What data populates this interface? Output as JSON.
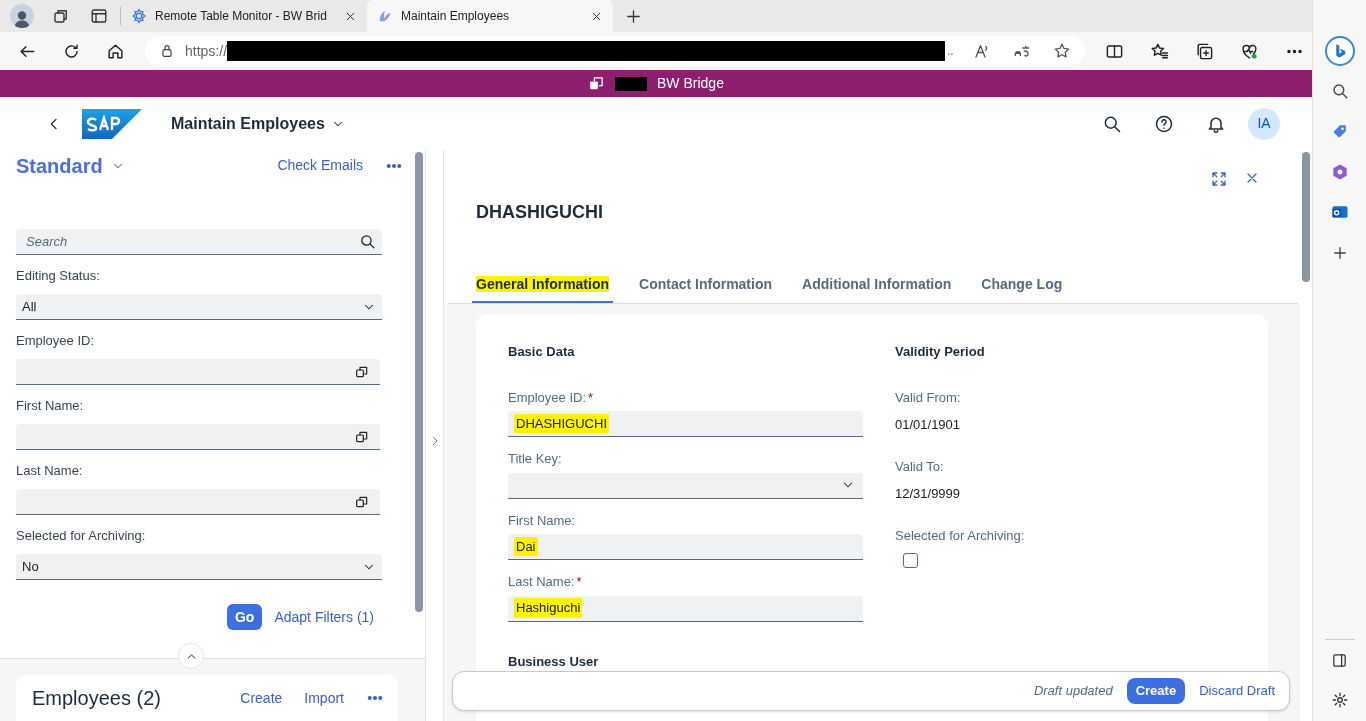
{
  "browser": {
    "tabs": [
      {
        "title": "Remote Table Monitor - BW Brid",
        "selected": false
      },
      {
        "title": "Maintain Employees",
        "selected": true
      }
    ],
    "url": "https://",
    "url_end": ".."
  },
  "banner": {
    "title": "BW Bridge"
  },
  "shell": {
    "title": "Maintain Employees",
    "avatar": "IA"
  },
  "filter_bar": {
    "variant": "Standard",
    "action": "Check Emails",
    "search": {
      "placeholder": "Search"
    },
    "fields": [
      {
        "label": "Editing Status:",
        "kind": "select",
        "value": "All"
      },
      {
        "label": "Employee ID:",
        "kind": "valuehelp"
      },
      {
        "label": "First Name:",
        "kind": "valuehelp"
      },
      {
        "label": "Last Name:",
        "kind": "valuehelp"
      },
      {
        "label": "Selected for Archiving:",
        "kind": "select",
        "value": "No"
      }
    ],
    "go": "Go",
    "adapt": "Adapt Filters (1)"
  },
  "list": {
    "title": "Employees (2)",
    "actions": [
      "Create",
      "Import"
    ]
  },
  "object": {
    "title": "DHASHIGUCHI",
    "tabs": [
      {
        "label": "General Information",
        "selected": true,
        "highlighted": true
      },
      {
        "label": "Contact Information",
        "selected": false,
        "highlighted": false
      },
      {
        "label": "Additional Information",
        "selected": false,
        "highlighted": false
      },
      {
        "label": "Change Log",
        "selected": false,
        "highlighted": false
      }
    ],
    "basic_data": {
      "title": "Basic Data",
      "fields": [
        {
          "label": "Employee ID:",
          "required_mark": "*",
          "kind": "input",
          "value": "DHASHIGUCHI",
          "highlighted": true
        },
        {
          "label": "Title Key:",
          "kind": "select"
        },
        {
          "label": "First Name:",
          "kind": "input",
          "value": "Dai",
          "highlighted": true
        },
        {
          "label": "Last Name:",
          "required_mark": "*",
          "kind": "input",
          "value": "Hashiguchi",
          "highlighted": true
        }
      ]
    },
    "validity": {
      "title": "Validity Period",
      "fields": [
        {
          "label": "Valid From:",
          "kind": "text",
          "value": "01/01/1901"
        },
        {
          "label": "Valid To:",
          "kind": "text",
          "value": "12/31/9999"
        },
        {
          "label": "Selected for Archiving:",
          "kind": "checkbox",
          "checked": false
        }
      ]
    },
    "next_section": "Business User"
  },
  "footer": {
    "status": "Draft updated",
    "primary": "Create",
    "secondary": "Discard Draft"
  }
}
